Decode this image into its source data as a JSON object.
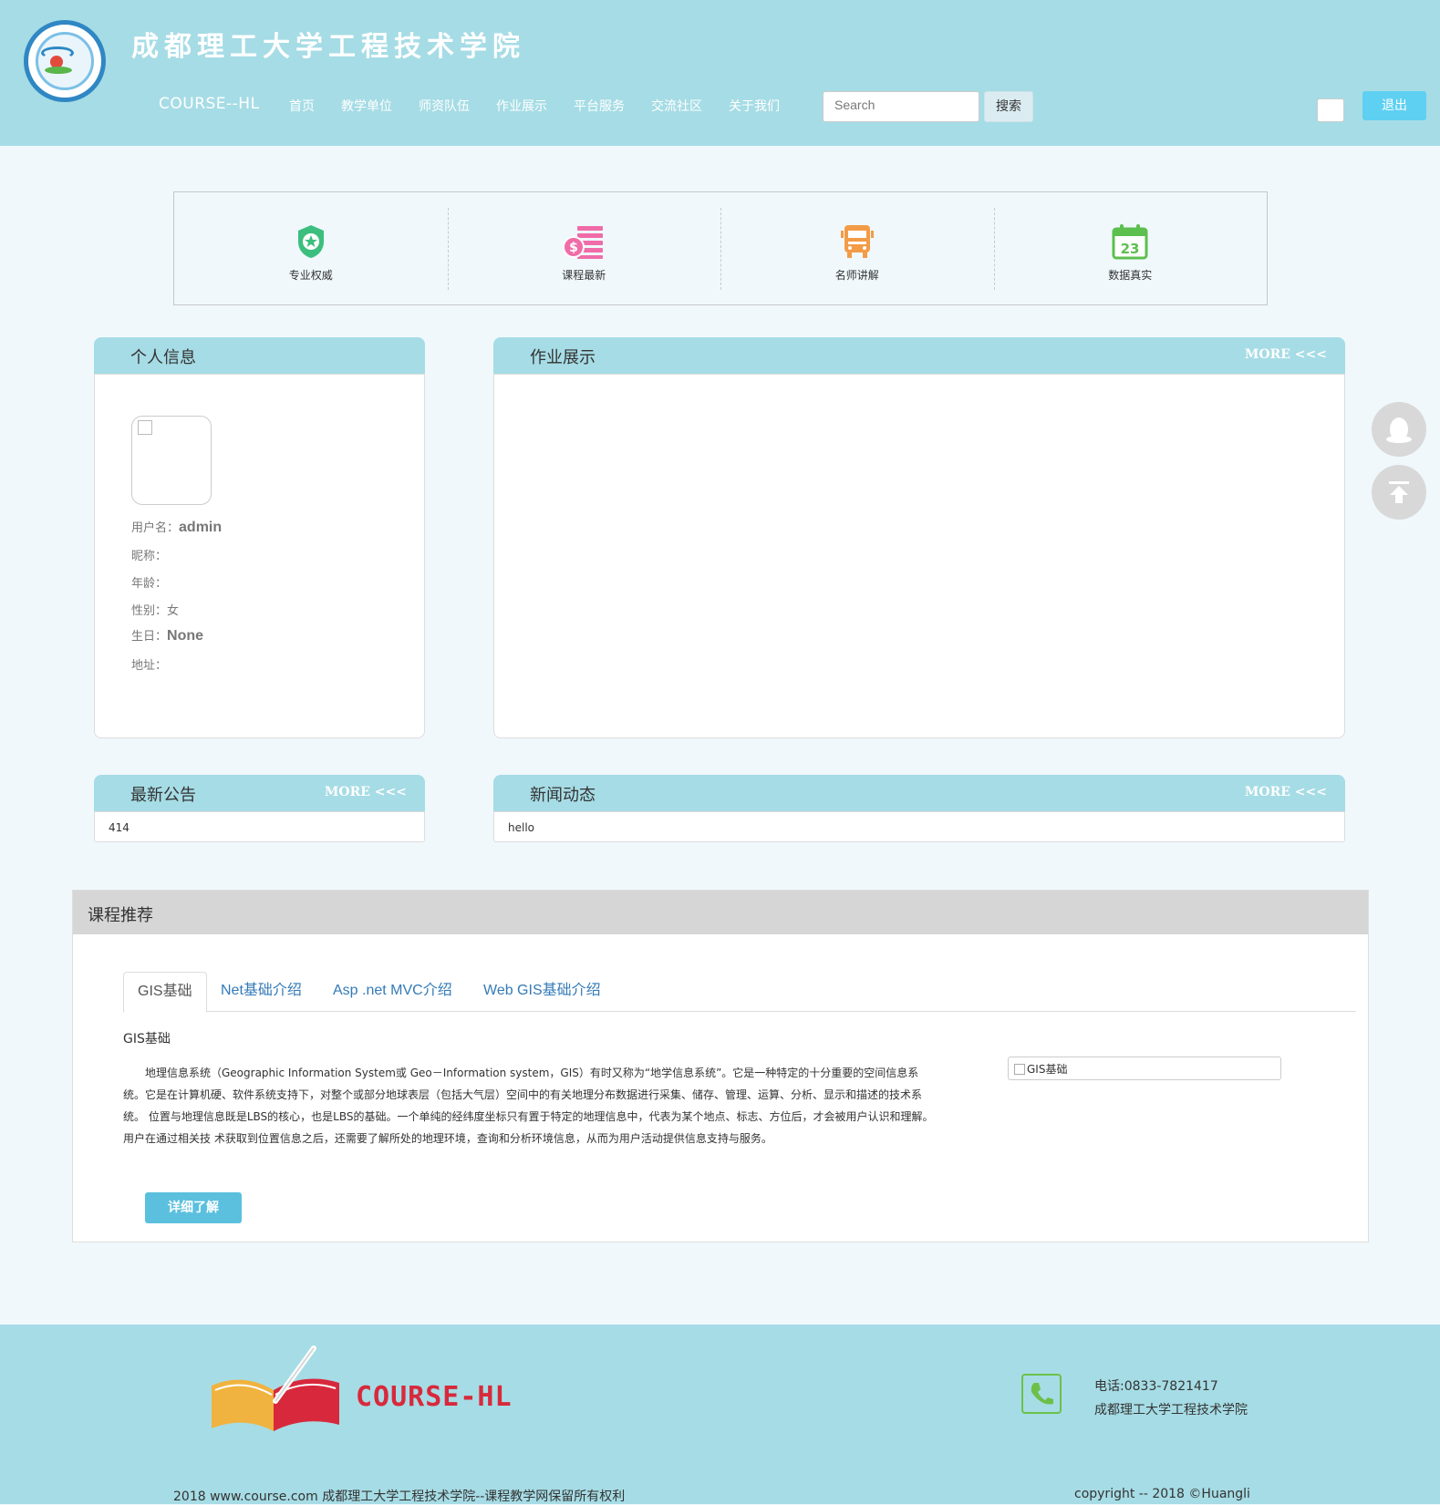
{
  "header": {
    "school_title": "成都理工大学工程技术学院",
    "brand": "COURSE--HL",
    "nav": [
      "首页",
      "教学单位",
      "师资队伍",
      "作业展示",
      "平台服务",
      "交流社区",
      "关于我们"
    ],
    "search_placeholder": "Search",
    "search_button": "搜索",
    "logout_button": "退出"
  },
  "features": [
    {
      "label": "专业权威",
      "icon": "shield-star-icon",
      "color": "#3cbf7e"
    },
    {
      "label": "课程最新",
      "icon": "money-list-icon",
      "color": "#f06ca8"
    },
    {
      "label": "名师讲解",
      "icon": "bus-icon",
      "color": "#f39b47"
    },
    {
      "label": "数据真实",
      "icon": "calendar-icon",
      "color": "#5cbf4e"
    }
  ],
  "profile": {
    "title": "个人信息",
    "fields": {
      "username_label": "用户名：",
      "username_value": "admin",
      "nickname_label": "昵称：",
      "age_label": "年龄：",
      "gender_label": "性别：",
      "gender_value": "女",
      "birthday_label": "生日：",
      "birthday_value": "None",
      "address_label": "地址："
    }
  },
  "homework": {
    "title": "作业展示",
    "more": "MORE <<<"
  },
  "announcements": {
    "title": "最新公告",
    "more": "MORE <<<",
    "items": [
      "414"
    ]
  },
  "news": {
    "title": "新闻动态",
    "more": "MORE <<<",
    "items": [
      "hello"
    ]
  },
  "courses": {
    "title": "课程推荐",
    "tabs": [
      "GIS基础",
      "Net基础介绍",
      "Asp .net MVC介绍",
      "Web GIS基础介绍"
    ],
    "active_tab": 0,
    "subtitle": "GIS基础",
    "paragraph": "地理信息系统（Geographic Information System或 Geo－Information system，GIS）有时又称为“地学信息系统”。它是一种特定的十分重要的空间信息系统。它是在计算机硬、软件系统支持下，对整个或部分地球表层（包括大气层）空间中的有关地理分布数据进行采集、储存、管理、运算、分析、显示和描述的技术系统。 位置与地理信息既是LBS的核心，也是LBS的基础。一个单纯的经纬度坐标只有置于特定的地理信息中，代表为某个地点、标志、方位后，才会被用户认识和理解。用户在通过相关技 术获取到位置信息之后，还需要了解所处的地理环境，查询和分析环境信息，从而为用户活动提供信息支持与服务。",
    "image_alt": "GIS基础",
    "detail_button": "详细了解"
  },
  "footer": {
    "logo_text": "COURSE-HL",
    "phone": "电话:0833-7821417",
    "school": "成都理工大学工程技术学院",
    "copyright_left": "2018 www.course.com 成都理工大学工程技术学院--课程教学网保留所有权利",
    "copyright_right": "copyright -- 2018 ©Huangli"
  },
  "colors": {
    "accent": "#a6dce5",
    "logout": "#5ed0f2",
    "detail_button": "#5bc0de"
  }
}
